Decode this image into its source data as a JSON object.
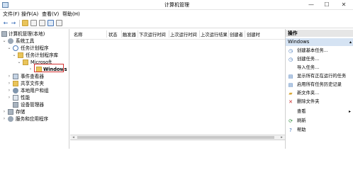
{
  "window": {
    "title": "计算机管理",
    "minimize": "—",
    "maximize": "☐",
    "close": "✕"
  },
  "menu": [
    "文件(F)",
    "操作(A)",
    "查看(V)",
    "帮助(H)"
  ],
  "toolbar": {
    "back": "←",
    "forward": "→"
  },
  "tree": {
    "items": [
      {
        "label": "计算机管理(本地)",
        "arrow": "",
        "icon": "computer-icon"
      },
      {
        "label": "系统工具",
        "arrow": "⌄",
        "icon": "tools-icon"
      },
      {
        "label": "任务计划程序",
        "arrow": "⌄",
        "icon": "clock-icon"
      },
      {
        "label": "任务计划程序库",
        "arrow": "⌄",
        "icon": "folder-icon"
      },
      {
        "label": "Microsoft",
        "arrow": "⌄",
        "icon": "folder-icon"
      },
      {
        "label": "Windows",
        "arrow": "›",
        "icon": "folder-icon"
      },
      {
        "label": "事件查看器",
        "arrow": "›",
        "icon": "event-icon"
      },
      {
        "label": "共享文件夹",
        "arrow": "›",
        "icon": "shared-folder-icon"
      },
      {
        "label": "本地用户和组",
        "arrow": "›",
        "icon": "users-icon"
      },
      {
        "label": "性能",
        "arrow": "›",
        "icon": "performance-icon"
      },
      {
        "label": "设备管理器",
        "arrow": "",
        "icon": "device-icon"
      },
      {
        "label": "存储",
        "arrow": "›",
        "icon": "storage-icon"
      },
      {
        "label": "服务和应用程序",
        "arrow": "›",
        "icon": "services-icon"
      }
    ]
  },
  "columns": [
    "名称",
    "状态",
    "触发器",
    "下次运行时间",
    "上次运行时间",
    "上次运行结果",
    "创建者",
    "创建时"
  ],
  "actions": {
    "header": "操作",
    "subheader": "Windows",
    "sub_arrow": "▴",
    "items": [
      {
        "label": "创建基本任务...",
        "icon": "create-basic-task-icon",
        "glyph": "◷",
        "color": "#3a6fb5"
      },
      {
        "label": "创建任务...",
        "icon": "create-task-icon",
        "glyph": "◷",
        "color": "#3a6fb5"
      },
      {
        "label": "导入任务...",
        "icon": "import-task-icon",
        "glyph": "",
        "color": "#3a6fb5"
      },
      {
        "label": "显示所有正在运行的任务",
        "icon": "running-tasks-icon",
        "glyph": "▤",
        "color": "#3a6fb5"
      },
      {
        "label": "启用所有任务历史记录",
        "icon": "history-icon",
        "glyph": "▤",
        "color": "#3a6fb5"
      },
      {
        "label": "新文件夹...",
        "icon": "new-folder-icon",
        "glyph": "▰",
        "color": "#d8a93a"
      },
      {
        "label": "删除文件夹",
        "icon": "delete-folder-icon",
        "glyph": "✕",
        "color": "#c62828"
      },
      {
        "label": "查看",
        "icon": "view-icon",
        "glyph": "",
        "color": "#3a6fb5",
        "more": "▸"
      },
      {
        "label": "刷新",
        "icon": "refresh-icon",
        "glyph": "⟳",
        "color": "#2e8b3a"
      },
      {
        "label": "帮助",
        "icon": "help-icon",
        "glyph": "?",
        "color": "#3a6fb5"
      }
    ]
  },
  "colors": {
    "selection_outline": "#d32f2f",
    "action_header_bg": "#e6e6e6",
    "action_subheader_bg": "#d5e3f3"
  }
}
